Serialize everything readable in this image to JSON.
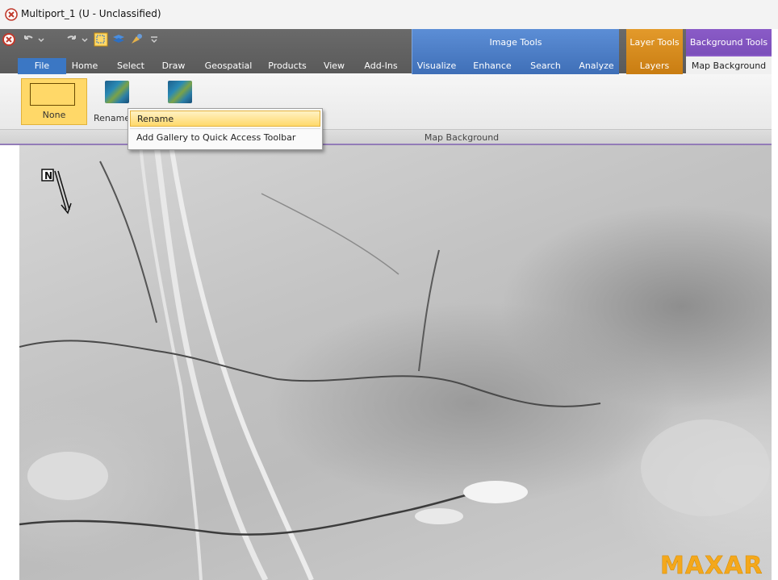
{
  "window": {
    "title": "Multiport_1 (U - Unclassified)"
  },
  "colors": {
    "image_tools": "#4a7fd0",
    "layer_tools": "#e39a2b",
    "background_tools": "#8a5bc7",
    "file_tab": "#3b77c4",
    "selected_item": "#ffd868"
  },
  "ribbon": {
    "tabs": [
      {
        "label": "File"
      },
      {
        "label": "Home"
      },
      {
        "label": "Select"
      },
      {
        "label": "Draw"
      },
      {
        "label": "Geospatial"
      },
      {
        "label": "Products"
      },
      {
        "label": "View"
      },
      {
        "label": "Add-Ins"
      },
      {
        "label": "Visualize"
      },
      {
        "label": "Enhance"
      },
      {
        "label": "Search"
      },
      {
        "label": "Analyze"
      },
      {
        "label": "Layers"
      },
      {
        "label": "Map Background"
      }
    ],
    "context_groups": {
      "image_tools": "Image Tools",
      "layer_tools": "Layer Tools",
      "background_tools": "Background Tools"
    },
    "gallery": {
      "items": [
        {
          "label": "None",
          "selected": true
        },
        {
          "label": "Renamed_"
        }
      ],
      "group_label": "Map Background"
    }
  },
  "context_menu": {
    "items": [
      {
        "label": "Rename"
      },
      {
        "label": "Add Gallery to Quick Access Toolbar"
      }
    ]
  },
  "map": {
    "north_arrow_label": "N",
    "logo_text": "MAXAR"
  }
}
